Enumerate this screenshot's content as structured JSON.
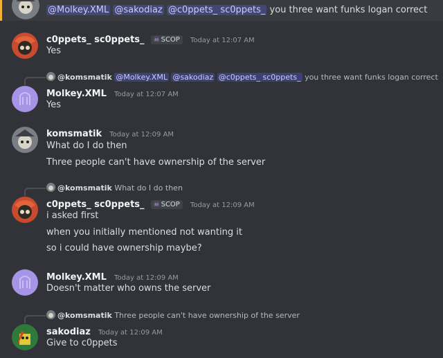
{
  "top_message": {
    "mentions": [
      "@Molkey.XML",
      "@sakodiaz",
      "@c0ppets_ sc0ppets_"
    ],
    "text": "you three want funks logan correct"
  },
  "messages": [
    {
      "author": "c0ppets_ sc0ppets_",
      "tag": "SCOP",
      "timestamp": "Today at 12:07 AM",
      "lines": [
        "Yes"
      ]
    },
    {
      "reply": {
        "author": "@komsmatik",
        "mentions": [
          "@Molkey.XML",
          "@sakodiaz",
          "@c0ppets_ sc0ppets_"
        ],
        "text": "you three want funks logan correct"
      },
      "author": "Molkey.XML",
      "timestamp": "Today at 12:07 AM",
      "lines": [
        "Yes"
      ]
    },
    {
      "author": "komsmatik",
      "timestamp": "Today at 12:09 AM",
      "lines": [
        "What do I do then",
        "Three people can't have ownership of the server"
      ]
    },
    {
      "reply": {
        "author": "@komsmatik",
        "text": "What do I do then"
      },
      "author": "c0ppets_ sc0ppets_",
      "tag": "SCOP",
      "timestamp": "Today at 12:09 AM",
      "lines": [
        "i asked first",
        "when you initially mentioned not wanting it",
        "so i could have ownership maybe?"
      ]
    },
    {
      "author": "Molkey.XML",
      "timestamp": "Today at 12:09 AM",
      "lines": [
        "Doesn't matter who owns the server"
      ]
    },
    {
      "reply": {
        "author": "@komsmatik",
        "text": "Three people can't have ownership of the server"
      },
      "author": "sakodiaz",
      "timestamp": "Today at 12:09 AM",
      "lines": [
        "Give to c0ppets"
      ]
    }
  ],
  "colors": {
    "background": "#313338",
    "mention_bg": "#3c4270",
    "highlight_bar": "#f0b232",
    "tag_icon": "#c597ff"
  }
}
